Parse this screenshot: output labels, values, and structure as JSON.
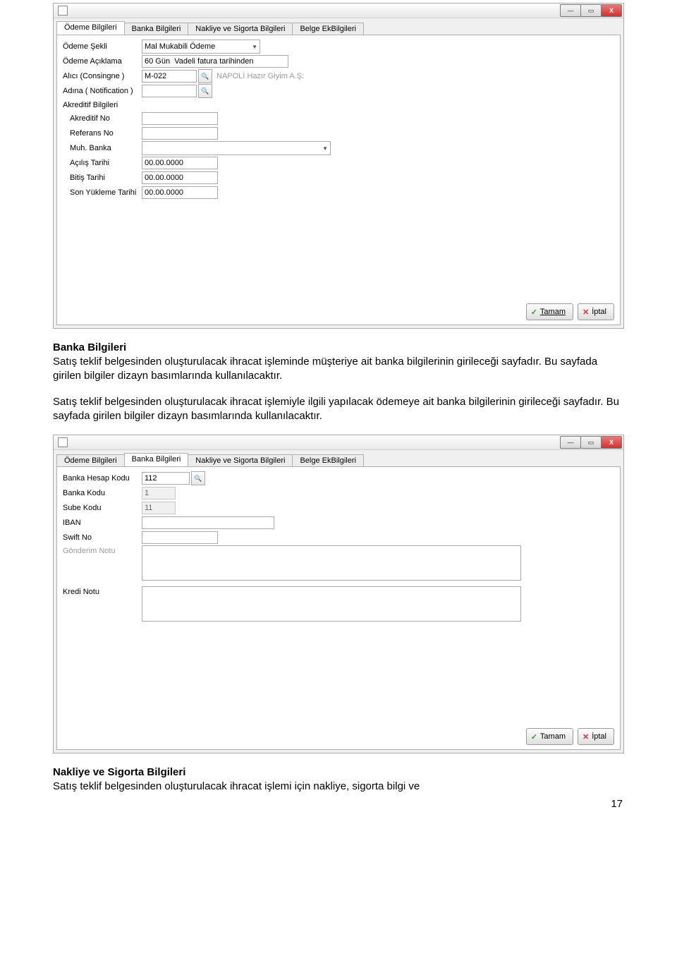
{
  "window1": {
    "titlebar_icon": "window-icon",
    "controls": {
      "min": "—",
      "max": "▭",
      "close": "X"
    },
    "tabs": [
      {
        "label": "Ödeme Bilgileri",
        "active": true
      },
      {
        "label": "Banka Bilgileri",
        "active": false
      },
      {
        "label": "Nakliye ve Sigorta Bilgileri",
        "active": false
      },
      {
        "label": "Belge EkBilgileri",
        "active": false
      }
    ],
    "fields": {
      "odeme_sekli_label": "Ödeme Şekli",
      "odeme_sekli_value": "Mal Mukabili Ödeme",
      "odeme_aciklama_label": "Ödeme Açıklama",
      "odeme_aciklama_value": "60 Gün  Vadeli fatura tarihinden",
      "alici_label": "Alıcı (Consingne )",
      "alici_value": "M-022",
      "alici_hint": "NAPOLİ Hazır Giyim A.Ş:",
      "adina_label": "Adına ( Notification )",
      "adina_value": "",
      "akreditif_section": "Akreditif Bilgileri",
      "akreditif_no_label": "Akreditif No",
      "akreditif_no_value": "",
      "referans_no_label": "Referans No",
      "referans_no_value": "",
      "muh_banka_label": "Muh. Banka",
      "muh_banka_value": "",
      "acilis_tarihi_label": "Açılış Tarihi",
      "acilis_tarihi_value": "00.00.0000",
      "bitis_tarihi_label": "Bitiş Tarihi",
      "bitis_tarihi_value": "00.00.0000",
      "son_yukleme_label": "Son Yükleme Tarihi",
      "son_yukleme_value": "00.00.0000"
    },
    "buttons": {
      "ok": "Tamam",
      "cancel": "İptal"
    }
  },
  "text_section1": {
    "heading": "Banka Bilgileri",
    "p1": "Satış teklif belgesinden oluşturulacak ihracat işleminde müşteriye ait banka bilgilerinin girileceği sayfadır. Bu sayfada girilen bilgiler dizayn basımlarında kullanılacaktır.",
    "p2": "Satış teklif belgesinden oluşturulacak ihracat işlemiyle ilgili yapılacak ödemeye ait banka bilgilerinin girileceği sayfadır. Bu sayfada girilen bilgiler dizayn basımlarında kullanılacaktır."
  },
  "window2": {
    "titlebar_icon": "window-icon",
    "controls": {
      "min": "—",
      "max": "▭",
      "close": "X"
    },
    "tabs": [
      {
        "label": "Ödeme Bilgileri",
        "active": false
      },
      {
        "label": "Banka Bilgileri",
        "active": true
      },
      {
        "label": "Nakliye ve Sigorta Bilgileri",
        "active": false
      },
      {
        "label": "Belge EkBilgileri",
        "active": false
      }
    ],
    "fields": {
      "banka_hesap_kodu_label": "Banka Hesap Kodu",
      "banka_hesap_kodu_value": "112",
      "banka_kodu_label": "Banka Kodu",
      "banka_kodu_value": "1",
      "sube_kodu_label": "Sube Kodu",
      "sube_kodu_value": "11",
      "iban_label": "IBAN",
      "iban_value": "",
      "swift_label": "Swift No",
      "swift_value": "",
      "gonderim_notu_label": "Gönderim Notu",
      "gonderim_notu_value": "",
      "kredi_notu_label": "Kredi Notu",
      "kredi_notu_value": ""
    },
    "buttons": {
      "ok": "Tamam",
      "cancel": "İptal"
    }
  },
  "text_section2": {
    "heading": "Nakliye ve Sigorta Bilgileri",
    "p1": "Satış teklif belgesinden oluşturulacak ihracat işlemi için nakliye, sigorta bilgi ve"
  },
  "page_number": "17"
}
